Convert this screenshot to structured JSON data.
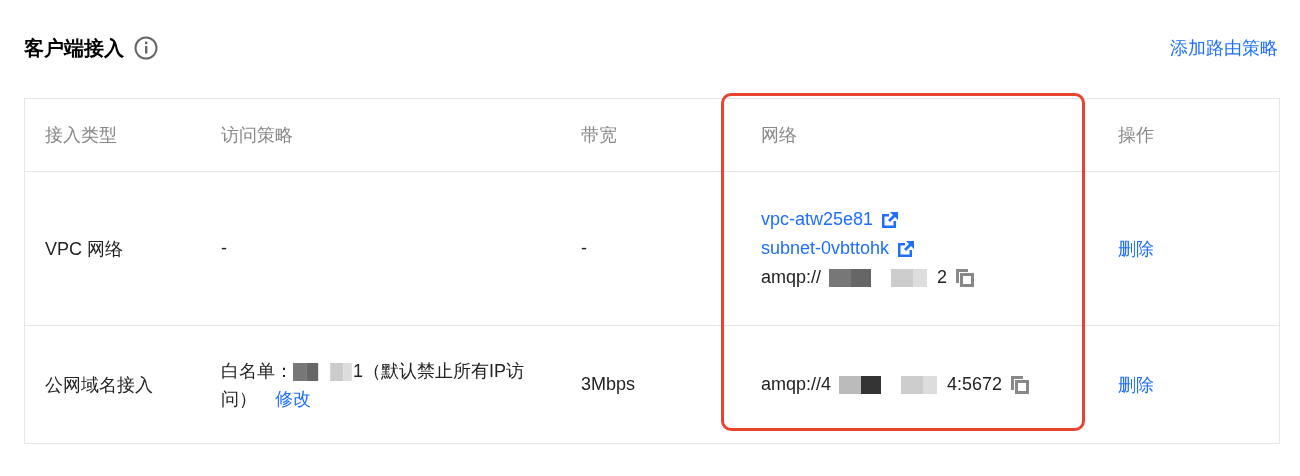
{
  "section": {
    "title": "客户端接入",
    "action": "添加路由策略"
  },
  "table": {
    "columns": [
      {
        "label": "接入类型",
        "highlighted": false
      },
      {
        "label": "访问策略",
        "highlighted": false
      },
      {
        "label": "带宽",
        "highlighted": false
      },
      {
        "label": "网络",
        "highlighted": true
      },
      {
        "label": "操作",
        "highlighted": false
      }
    ],
    "rows": [
      {
        "type": "VPC 网络",
        "policy": {
          "text": "-"
        },
        "bandwidth": "-",
        "network": {
          "links": [
            "vpc-atw25e81",
            "subnet-0vbttohk"
          ],
          "address_start": "amqp://",
          "address_end": "2"
        },
        "action": "删除"
      },
      {
        "type": "公网域名接入",
        "policy": {
          "prefix": "白名单：",
          "rest": "1（默认禁止所有IP访问）",
          "link": "修改"
        },
        "bandwidth": "3Mbps",
        "network": {
          "address_start": "amqp://4",
          "address_end": "4:5672"
        },
        "action": "删除"
      }
    ]
  }
}
